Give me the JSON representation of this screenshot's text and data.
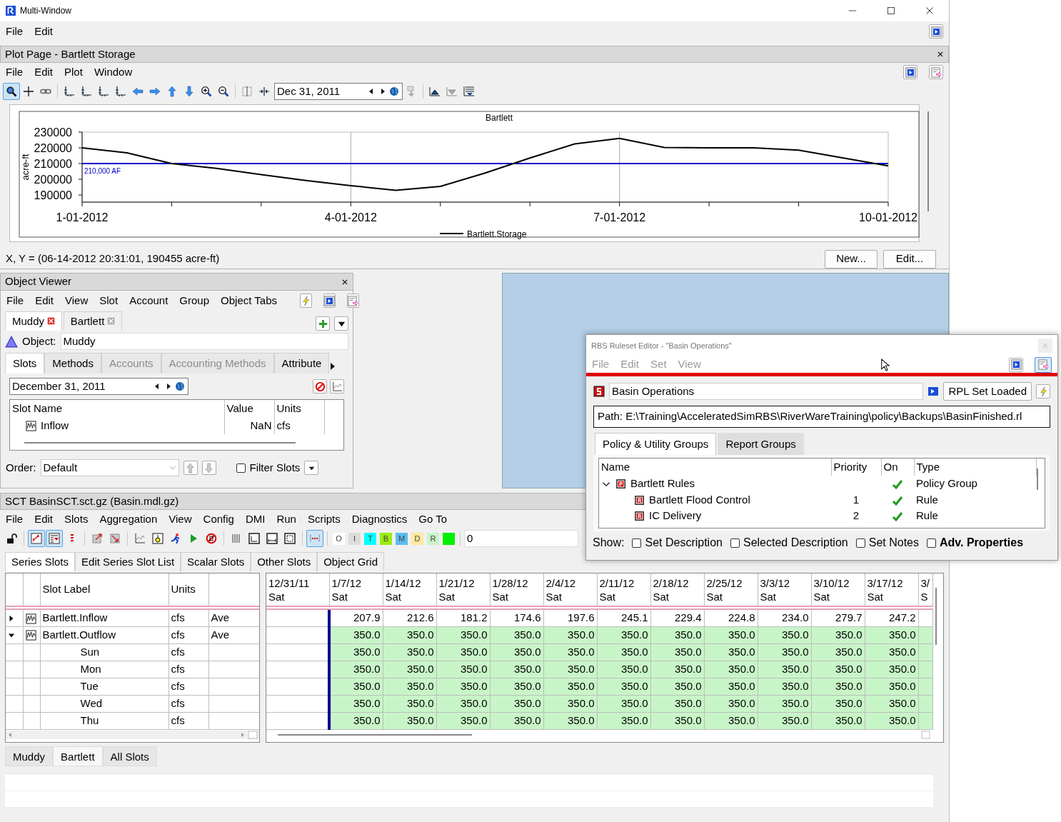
{
  "window": {
    "title": "Multi-Window",
    "menu": [
      "File",
      "Edit"
    ]
  },
  "plot_page": {
    "title": "Plot Page - Bartlett Storage",
    "menu": [
      "File",
      "Edit",
      "Plot",
      "Window"
    ],
    "tools": [
      {
        "selected": true
      },
      {
        "selected": false
      },
      {
        "selected": false
      },
      {
        "selected": false
      },
      {
        "selected": false
      },
      {
        "selected": false
      },
      {
        "selected": false
      },
      {
        "selected": false
      },
      {
        "selected": false
      },
      {
        "selected": false
      },
      {
        "selected": false
      },
      {
        "selected": false
      },
      {
        "selected": false
      },
      {
        "selected": false
      },
      {
        "selected": false
      }
    ],
    "date": "Dec 31, 2011",
    "chart_tools": [
      {
        "selected": false
      },
      {
        "selected": false
      },
      {
        "selected": false
      },
      {
        "selected": false
      }
    ],
    "chart_data": {
      "type": "line",
      "title": "Bartlett",
      "ylabel": "acre-ft",
      "categories": [
        "1-01-2012",
        null,
        null,
        null,
        null,
        null,
        "4-01-2012",
        null,
        null,
        null,
        null,
        null,
        "7-01-2012",
        null,
        null,
        null,
        null,
        null,
        "10-01-2012"
      ],
      "series": [
        {
          "name": "Bartlett.Storage",
          "color": "#000000",
          "values": [
            220000,
            216800,
            210000,
            207000,
            203000,
            199200,
            196000,
            193000,
            195500,
            204000,
            213500,
            222500,
            226000,
            220300,
            220000,
            220000,
            218500,
            213500,
            208500
          ]
        }
      ],
      "ylim": [
        185500,
        230000
      ],
      "yticks": [
        190000,
        200000,
        210000,
        220000,
        230000
      ],
      "ref_lines": [
        {
          "axis": "y",
          "value": 210000,
          "label": "210,000 AF",
          "color": "#0000cc"
        }
      ]
    },
    "status": "X, Y = (06-14-2012 20:31:01, 190455 acre-ft)",
    "buttons": [
      "New...",
      "Edit..."
    ]
  },
  "object_viewer": {
    "title": "Object Viewer",
    "menu": [
      "File",
      "Edit",
      "View",
      "Slot",
      "Account",
      "Group",
      "Object Tabs"
    ],
    "object_tabs": [
      {
        "label": "Muddy",
        "selected": true
      },
      {
        "label": "Bartlett",
        "selected": false
      }
    ],
    "object_label": "Object:",
    "object": "Muddy",
    "tabs": [
      {
        "label": "Slots",
        "selected": true,
        "disabled": false
      },
      {
        "label": "Methods",
        "selected": false,
        "disabled": false
      },
      {
        "label": "Accounts",
        "selected": false,
        "disabled": true
      },
      {
        "label": "Accounting Methods",
        "selected": false,
        "disabled": true
      },
      {
        "label": "Attribute",
        "selected": false,
        "disabled": false
      }
    ],
    "date": "December 31, 2011",
    "columns": [
      "Slot Name",
      "Value",
      "Units"
    ],
    "slots": [
      {
        "name": "Inflow",
        "value": "NaN",
        "units": "cfs"
      }
    ],
    "order_label": "Order:",
    "order": "Default",
    "filter": {
      "label": "Filter Slots",
      "checked": false
    }
  },
  "sct": {
    "title": "SCT BasinSCT.sct.gz (Basin.mdl.gz)",
    "menu": [
      "File",
      "Edit",
      "Slots",
      "Aggregation",
      "View",
      "Config",
      "DMI",
      "Run",
      "Scripts",
      "Diagnostics",
      "Go To"
    ],
    "tools": [
      {
        "selected": false
      },
      {
        "selected": true
      },
      {
        "selected": true
      },
      {
        "selected": false
      },
      {
        "selected": false
      },
      {
        "selected": false
      },
      {
        "selected": false
      },
      {
        "selected": false
      },
      {
        "selected": false
      },
      {
        "selected": false
      },
      {
        "selected": false
      },
      {
        "selected": false
      },
      {
        "selected": false
      },
      {
        "selected": false
      },
      {
        "selected": false
      },
      {
        "selected": true
      }
    ],
    "flags": [
      {
        "label": "O",
        "color": "#ffffff"
      },
      {
        "label": "I",
        "color": "#dddddd"
      },
      {
        "label": "T",
        "color": "#00ffff"
      },
      {
        "label": "B",
        "color": "#99ee11"
      },
      {
        "label": "M",
        "color": "#5bbcee"
      },
      {
        "label": "D",
        "color": "#ffe8a0"
      },
      {
        "label": "R",
        "color": "#c8f5c8"
      },
      {
        "color": "#00ee00"
      }
    ],
    "index": "0",
    "tabs": [
      {
        "label": "Series Slots",
        "selected": true
      },
      {
        "label": "Edit Series Slot List",
        "selected": false
      },
      {
        "label": "Scalar Slots",
        "selected": false
      },
      {
        "label": "Other Slots",
        "selected": false
      },
      {
        "label": "Object Grid",
        "selected": false
      }
    ],
    "label_columns": [
      "Slot Label",
      "Units"
    ],
    "date_columns": [
      {
        "date": "12/31/11",
        "day": "Sat"
      },
      {
        "date": "1/7/12",
        "day": "Sat"
      },
      {
        "date": "1/14/12",
        "day": "Sat"
      },
      {
        "date": "1/21/12",
        "day": "Sat"
      },
      {
        "date": "1/28/12",
        "day": "Sat"
      },
      {
        "date": "2/4/12",
        "day": "Sat"
      },
      {
        "date": "2/11/12",
        "day": "Sat"
      },
      {
        "date": "2/18/12",
        "day": "Sat"
      },
      {
        "date": "2/25/12",
        "day": "Sat"
      },
      {
        "date": "3/3/12",
        "day": "Sat"
      },
      {
        "date": "3/10/12",
        "day": "Sat"
      },
      {
        "date": "3/17/12",
        "day": "Sat"
      },
      {
        "date": "3/",
        "day": "S"
      }
    ],
    "slots": [
      {
        "label": "Bartlett.Inflow",
        "units": "cfs",
        "aggregation": "Ave",
        "expanded": false,
        "color": "#ffffff",
        "values": [
          "207.9",
          "212.6",
          "181.2",
          "174.6",
          "197.6",
          "245.1",
          "229.4",
          "224.8",
          "234.0",
          "279.7",
          "247.2"
        ]
      },
      {
        "label": "Bartlett.Outflow",
        "units": "cfs",
        "aggregation": "Ave",
        "expanded": true,
        "color": "#c8f5c8",
        "values": [
          "350.0",
          "350.0",
          "350.0",
          "350.0",
          "350.0",
          "350.0",
          "350.0",
          "350.0",
          "350.0",
          "350.0",
          "350.0"
        ],
        "children": [
          {
            "label": "Sun",
            "units": "cfs",
            "color": "#c8f5c8",
            "values": [
              "350.0",
              "350.0",
              "350.0",
              "350.0",
              "350.0",
              "350.0",
              "350.0",
              "350.0",
              "350.0",
              "350.0",
              "350.0"
            ]
          },
          {
            "label": "Mon",
            "units": "cfs",
            "color": "#c8f5c8",
            "values": [
              "350.0",
              "350.0",
              "350.0",
              "350.0",
              "350.0",
              "350.0",
              "350.0",
              "350.0",
              "350.0",
              "350.0",
              "350.0"
            ]
          },
          {
            "label": "Tue",
            "units": "cfs",
            "color": "#c8f5c8",
            "values": [
              "350.0",
              "350.0",
              "350.0",
              "350.0",
              "350.0",
              "350.0",
              "350.0",
              "350.0",
              "350.0",
              "350.0",
              "350.0"
            ]
          },
          {
            "label": "Wed",
            "units": "cfs",
            "color": "#c8f5c8",
            "values": [
              "350.0",
              "350.0",
              "350.0",
              "350.0",
              "350.0",
              "350.0",
              "350.0",
              "350.0",
              "350.0",
              "350.0",
              "350.0"
            ]
          },
          {
            "label": "Thu",
            "units": "cfs",
            "color": "#c8f5c8",
            "values": [
              "350.0",
              "350.0",
              "350.0",
              "350.0",
              "350.0",
              "350.0",
              "350.0",
              "350.0",
              "350.0",
              "350.0",
              "350.0"
            ]
          }
        ]
      }
    ],
    "bottom_tabs": [
      {
        "label": "Muddy",
        "selected": false
      },
      {
        "label": "Bartlett",
        "selected": true
      },
      {
        "label": "All Slots",
        "selected": false
      }
    ]
  },
  "rbs": {
    "title": "RBS Ruleset Editor - \"Basin Operations\"",
    "active": false,
    "menu": [
      "File",
      "Edit",
      "Set",
      "View"
    ],
    "name": "Basin Operations",
    "load_button": "RPL Set Loaded",
    "path": "Path: E:\\Training\\AcceleratedSimRBS\\RiverWareTraining\\policy\\Backups\\BasinFinished.rl",
    "tabs": [
      {
        "label": "Policy & Utility Groups",
        "selected": true
      },
      {
        "label": "Report Groups",
        "selected": false
      }
    ],
    "columns": [
      "Name",
      "Priority",
      "On",
      "Type"
    ],
    "rules": [
      {
        "name": "Bartlett Rules",
        "type": "Policy Group",
        "on": true,
        "expanded": true,
        "children": [
          {
            "name": "Bartlett Flood Control",
            "priority": "1",
            "on": true,
            "type": "Rule"
          },
          {
            "name": "IC Delivery",
            "priority": "2",
            "on": true,
            "type": "Rule"
          }
        ]
      }
    ],
    "show_label": "Show:",
    "show": [
      {
        "label": "Set Description",
        "checked": false,
        "bold": false
      },
      {
        "label": "Selected Description",
        "checked": false,
        "bold": false
      },
      {
        "label": "Set Notes",
        "checked": false,
        "bold": false
      },
      {
        "label": "Adv. Properties",
        "checked": false,
        "bold": true
      }
    ]
  }
}
